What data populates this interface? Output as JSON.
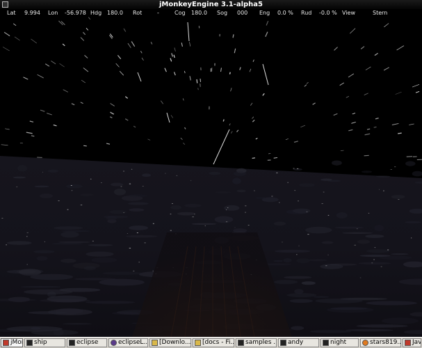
{
  "window": {
    "title": "jMonkeyEngine 3.1-alpha5"
  },
  "hud": {
    "lat_label": "Lat",
    "lat_value": "9.994",
    "lon_label": "Lon",
    "lon_value": "-56.978",
    "hdg_label": "Hdg",
    "hdg_value": "180.0",
    "rot_label": "Rot",
    "rot_value": "-",
    "cog_label": "Cog",
    "cog_value": "180.0",
    "sog_label": "Sog",
    "sog_value": "000",
    "eng_label": "Eng",
    "eng_value": "0.0 %",
    "rud_label": "Rud",
    "rud_value": "-0.0 %",
    "view_label": "View",
    "view_value": "Stern"
  },
  "taskbar": {
    "items": [
      {
        "label": "jMon...",
        "icon": "java-icon"
      },
      {
        "label": "ship",
        "icon": "terminal-icon"
      },
      {
        "label": "eclipse",
        "icon": "terminal-icon"
      },
      {
        "label": "eclipseL...",
        "icon": "eclipse-icon"
      },
      {
        "label": "[Downlo...",
        "icon": "folder-icon"
      },
      {
        "label": "[docs - Fi...",
        "icon": "folder-icon"
      },
      {
        "label": "samples ...",
        "icon": "terminal-icon"
      },
      {
        "label": "andy",
        "icon": "terminal-icon"
      },
      {
        "label": "night",
        "icon": "terminal-icon"
      },
      {
        "label": "stars819...",
        "icon": "firefox-icon"
      },
      {
        "label": "Jav",
        "icon": "java-icon"
      }
    ]
  },
  "colors": {
    "sky": "#000000",
    "sea": "#15141e",
    "hud_text": "#e8e8e8",
    "taskbar": "#d4d0c8"
  }
}
